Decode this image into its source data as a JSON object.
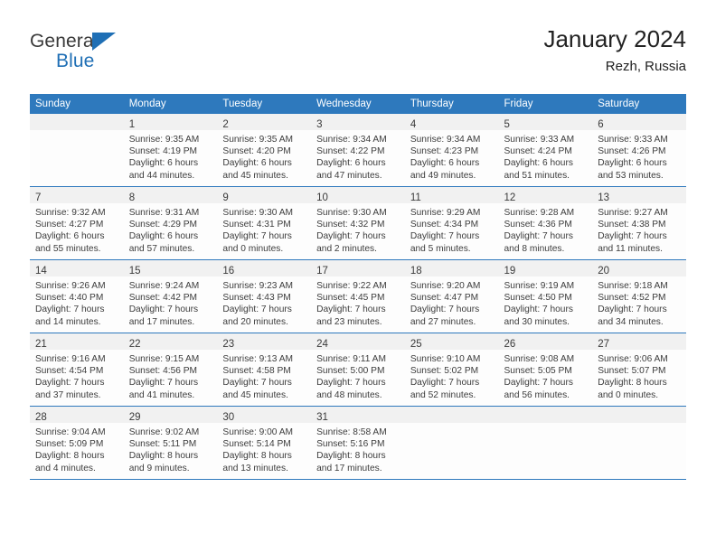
{
  "brand": {
    "name_part1": "General",
    "name_part2": "Blue",
    "flag_icon": "triangle-flag-icon",
    "accent_color": "#1f6fb5"
  },
  "header": {
    "title": "January 2024",
    "location": "Rezh, Russia"
  },
  "theme": {
    "header_bg": "#2e79bd",
    "header_text": "#ffffff",
    "daynum_band_bg": "#f1f1f1",
    "cell_bg": "#fdfdfd",
    "week_divider": "#2e79bd"
  },
  "calendar": {
    "weekday_headers": [
      "Sunday",
      "Monday",
      "Tuesday",
      "Wednesday",
      "Thursday",
      "Friday",
      "Saturday"
    ],
    "weeks": [
      [
        {
          "day": "",
          "lines": []
        },
        {
          "day": "1",
          "lines": [
            "Sunrise: 9:35 AM",
            "Sunset: 4:19 PM",
            "Daylight: 6 hours",
            "and 44 minutes."
          ]
        },
        {
          "day": "2",
          "lines": [
            "Sunrise: 9:35 AM",
            "Sunset: 4:20 PM",
            "Daylight: 6 hours",
            "and 45 minutes."
          ]
        },
        {
          "day": "3",
          "lines": [
            "Sunrise: 9:34 AM",
            "Sunset: 4:22 PM",
            "Daylight: 6 hours",
            "and 47 minutes."
          ]
        },
        {
          "day": "4",
          "lines": [
            "Sunrise: 9:34 AM",
            "Sunset: 4:23 PM",
            "Daylight: 6 hours",
            "and 49 minutes."
          ]
        },
        {
          "day": "5",
          "lines": [
            "Sunrise: 9:33 AM",
            "Sunset: 4:24 PM",
            "Daylight: 6 hours",
            "and 51 minutes."
          ]
        },
        {
          "day": "6",
          "lines": [
            "Sunrise: 9:33 AM",
            "Sunset: 4:26 PM",
            "Daylight: 6 hours",
            "and 53 minutes."
          ]
        }
      ],
      [
        {
          "day": "7",
          "lines": [
            "Sunrise: 9:32 AM",
            "Sunset: 4:27 PM",
            "Daylight: 6 hours",
            "and 55 minutes."
          ]
        },
        {
          "day": "8",
          "lines": [
            "Sunrise: 9:31 AM",
            "Sunset: 4:29 PM",
            "Daylight: 6 hours",
            "and 57 minutes."
          ]
        },
        {
          "day": "9",
          "lines": [
            "Sunrise: 9:30 AM",
            "Sunset: 4:31 PM",
            "Daylight: 7 hours",
            "and 0 minutes."
          ]
        },
        {
          "day": "10",
          "lines": [
            "Sunrise: 9:30 AM",
            "Sunset: 4:32 PM",
            "Daylight: 7 hours",
            "and 2 minutes."
          ]
        },
        {
          "day": "11",
          "lines": [
            "Sunrise: 9:29 AM",
            "Sunset: 4:34 PM",
            "Daylight: 7 hours",
            "and 5 minutes."
          ]
        },
        {
          "day": "12",
          "lines": [
            "Sunrise: 9:28 AM",
            "Sunset: 4:36 PM",
            "Daylight: 7 hours",
            "and 8 minutes."
          ]
        },
        {
          "day": "13",
          "lines": [
            "Sunrise: 9:27 AM",
            "Sunset: 4:38 PM",
            "Daylight: 7 hours",
            "and 11 minutes."
          ]
        }
      ],
      [
        {
          "day": "14",
          "lines": [
            "Sunrise: 9:26 AM",
            "Sunset: 4:40 PM",
            "Daylight: 7 hours",
            "and 14 minutes."
          ]
        },
        {
          "day": "15",
          "lines": [
            "Sunrise: 9:24 AM",
            "Sunset: 4:42 PM",
            "Daylight: 7 hours",
            "and 17 minutes."
          ]
        },
        {
          "day": "16",
          "lines": [
            "Sunrise: 9:23 AM",
            "Sunset: 4:43 PM",
            "Daylight: 7 hours",
            "and 20 minutes."
          ]
        },
        {
          "day": "17",
          "lines": [
            "Sunrise: 9:22 AM",
            "Sunset: 4:45 PM",
            "Daylight: 7 hours",
            "and 23 minutes."
          ]
        },
        {
          "day": "18",
          "lines": [
            "Sunrise: 9:20 AM",
            "Sunset: 4:47 PM",
            "Daylight: 7 hours",
            "and 27 minutes."
          ]
        },
        {
          "day": "19",
          "lines": [
            "Sunrise: 9:19 AM",
            "Sunset: 4:50 PM",
            "Daylight: 7 hours",
            "and 30 minutes."
          ]
        },
        {
          "day": "20",
          "lines": [
            "Sunrise: 9:18 AM",
            "Sunset: 4:52 PM",
            "Daylight: 7 hours",
            "and 34 minutes."
          ]
        }
      ],
      [
        {
          "day": "21",
          "lines": [
            "Sunrise: 9:16 AM",
            "Sunset: 4:54 PM",
            "Daylight: 7 hours",
            "and 37 minutes."
          ]
        },
        {
          "day": "22",
          "lines": [
            "Sunrise: 9:15 AM",
            "Sunset: 4:56 PM",
            "Daylight: 7 hours",
            "and 41 minutes."
          ]
        },
        {
          "day": "23",
          "lines": [
            "Sunrise: 9:13 AM",
            "Sunset: 4:58 PM",
            "Daylight: 7 hours",
            "and 45 minutes."
          ]
        },
        {
          "day": "24",
          "lines": [
            "Sunrise: 9:11 AM",
            "Sunset: 5:00 PM",
            "Daylight: 7 hours",
            "and 48 minutes."
          ]
        },
        {
          "day": "25",
          "lines": [
            "Sunrise: 9:10 AM",
            "Sunset: 5:02 PM",
            "Daylight: 7 hours",
            "and 52 minutes."
          ]
        },
        {
          "day": "26",
          "lines": [
            "Sunrise: 9:08 AM",
            "Sunset: 5:05 PM",
            "Daylight: 7 hours",
            "and 56 minutes."
          ]
        },
        {
          "day": "27",
          "lines": [
            "Sunrise: 9:06 AM",
            "Sunset: 5:07 PM",
            "Daylight: 8 hours",
            "and 0 minutes."
          ]
        }
      ],
      [
        {
          "day": "28",
          "lines": [
            "Sunrise: 9:04 AM",
            "Sunset: 5:09 PM",
            "Daylight: 8 hours",
            "and 4 minutes."
          ]
        },
        {
          "day": "29",
          "lines": [
            "Sunrise: 9:02 AM",
            "Sunset: 5:11 PM",
            "Daylight: 8 hours",
            "and 9 minutes."
          ]
        },
        {
          "day": "30",
          "lines": [
            "Sunrise: 9:00 AM",
            "Sunset: 5:14 PM",
            "Daylight: 8 hours",
            "and 13 minutes."
          ]
        },
        {
          "day": "31",
          "lines": [
            "Sunrise: 8:58 AM",
            "Sunset: 5:16 PM",
            "Daylight: 8 hours",
            "and 17 minutes."
          ]
        },
        {
          "day": "",
          "lines": []
        },
        {
          "day": "",
          "lines": []
        },
        {
          "day": "",
          "lines": []
        }
      ]
    ]
  }
}
